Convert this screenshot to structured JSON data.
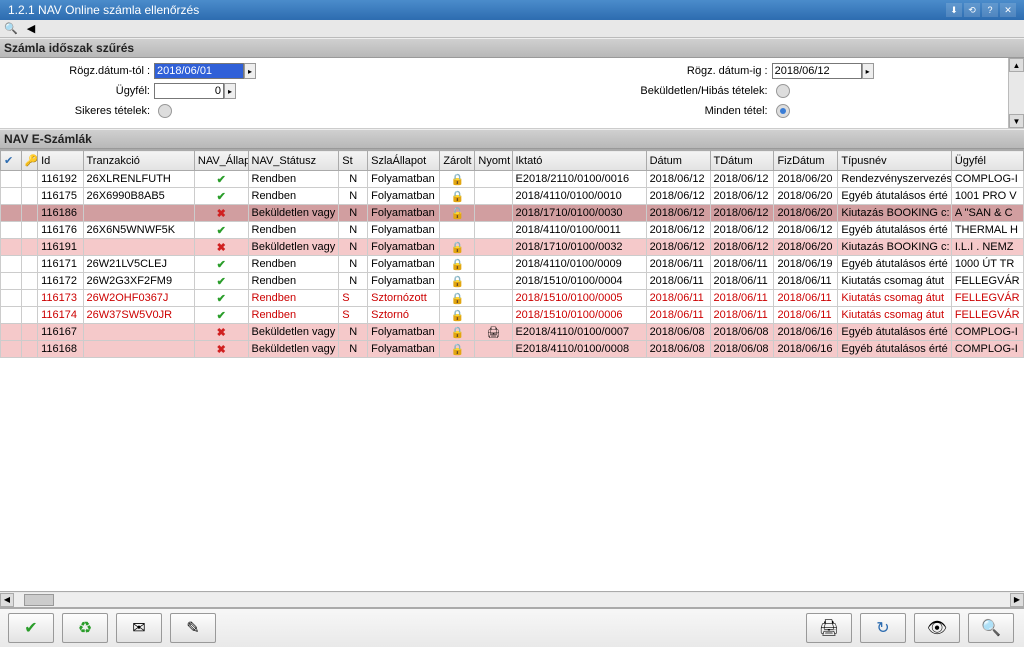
{
  "windowTitle": "1.2.1 NAV Online számla ellenőrzés",
  "filterHeader": "Számla időszak szűrés",
  "filters": {
    "rogzTolLabel": "Rögz.dátum-tól :",
    "rogzTolValue": "2018/06/01",
    "rogzIgLabel": "Rögz. dátum-ig :",
    "rogzIgValue": "2018/06/12",
    "ugyfelLabel": "Ügyfél:",
    "ugyfelValue": "0",
    "bekuldetlenLabel": "Beküldetlen/Hibás tételek:",
    "sikeresLabel": "Sikeres tételek:",
    "mindenLabel": "Minden tétel:"
  },
  "gridHeader": "NAV E-Számlák",
  "columns": {
    "id": "Id",
    "tranzakcio": "Tranzakció",
    "navAllap": "NAV_Állap",
    "navStatusz": "NAV_Státusz",
    "st": "St",
    "szlaAllapot": "SzlaÁllapot",
    "zarolt": "Zárolt",
    "nyomt": "Nyomt",
    "iktato": "Iktató",
    "datum": "Dátum",
    "tdatum": "TDátum",
    "fizdatum": "FizDátum",
    "tipusnev": "Típusnév",
    "ugyfel": "Ügyfél"
  },
  "rows": [
    {
      "id": "116192",
      "tran": "26XLRENLFUTH",
      "ok": true,
      "stat": "Rendben",
      "st": "N",
      "szla": "Folyamatban",
      "lock": "1",
      "ny": "",
      "ikt": "E2018/2110/0100/0016",
      "dat": "2018/06/12",
      "tdat": "2018/06/12",
      "fdat": "2018/06/20",
      "tip": "Rendezvényszervezés",
      "ugy": "COMPLOG-I",
      "cls": ""
    },
    {
      "id": "116175",
      "tran": "26X6990B8AB5",
      "ok": true,
      "stat": "Rendben",
      "st": "N",
      "szla": "Folyamatban",
      "lock": "1",
      "ny": "",
      "ikt": "2018/4110/0100/0010",
      "dat": "2018/06/12",
      "tdat": "2018/06/12",
      "fdat": "2018/06/20",
      "tip": "Egyéb átutalásos érté",
      "ugy": "1001 PRO V",
      "cls": ""
    },
    {
      "id": "116186",
      "tran": "",
      "ok": false,
      "stat": "Beküldetlen vagy",
      "st": "N",
      "szla": "Folyamatban",
      "lock": "2",
      "ny": "",
      "ikt": "2018/1710/0100/0030",
      "dat": "2018/06/12",
      "tdat": "2018/06/12",
      "fdat": "2018/06/20",
      "tip": "Kiutazás BOOKING c:",
      "ugy": "A \"SAN & C",
      "cls": "sel"
    },
    {
      "id": "116176",
      "tran": "26X6N5WNWF5K",
      "ok": true,
      "stat": "Rendben",
      "st": "N",
      "szla": "Folyamatban",
      "lock": "",
      "ny": "",
      "ikt": "2018/4110/0100/0011",
      "dat": "2018/06/12",
      "tdat": "2018/06/12",
      "fdat": "2018/06/12",
      "tip": "Egyéb átutalásos érté",
      "ugy": "THERMAL H",
      "cls": ""
    },
    {
      "id": "116191",
      "tran": "",
      "ok": false,
      "stat": "Beküldetlen vagy",
      "st": "N",
      "szla": "Folyamatban",
      "lock": "1",
      "ny": "",
      "ikt": "2018/1710/0100/0032",
      "dat": "2018/06/12",
      "tdat": "2018/06/12",
      "fdat": "2018/06/20",
      "tip": "Kiutazás BOOKING c:",
      "ugy": "I.L.I .  NEMZ",
      "cls": "pink"
    },
    {
      "id": "116171",
      "tran": "26W21LV5CLEJ",
      "ok": true,
      "stat": "Rendben",
      "st": "N",
      "szla": "Folyamatban",
      "lock": "1",
      "ny": "",
      "ikt": "2018/4110/0100/0009",
      "dat": "2018/06/11",
      "tdat": "2018/06/11",
      "fdat": "2018/06/19",
      "tip": "Egyéb átutalásos érté",
      "ugy": "1000 ÚT TR",
      "cls": ""
    },
    {
      "id": "116172",
      "tran": "26W2G3XF2FM9",
      "ok": true,
      "stat": "Rendben",
      "st": "N",
      "szla": "Folyamatban",
      "lock": "1",
      "ny": "",
      "ikt": "2018/1510/0100/0004",
      "dat": "2018/06/11",
      "tdat": "2018/06/11",
      "fdat": "2018/06/11",
      "tip": "Kiutatás  csomag átut",
      "ugy": "FELLEGVÁR",
      "cls": ""
    },
    {
      "id": "116173",
      "tran": "26W2OHF0367J",
      "ok": true,
      "stat": "Rendben",
      "st": "S",
      "szla": "Sztornózott",
      "lock": "1",
      "ny": "",
      "ikt": "2018/1510/0100/0005",
      "dat": "2018/06/11",
      "tdat": "2018/06/11",
      "fdat": "2018/06/11",
      "tip": "Kiutatás  csomag átut",
      "ugy": "FELLEGVÁR",
      "cls": "red"
    },
    {
      "id": "116174",
      "tran": "26W37SW5V0JR",
      "ok": true,
      "stat": "Rendben",
      "st": "S",
      "szla": "Sztornó",
      "lock": "1",
      "ny": "",
      "ikt": "2018/1510/0100/0006",
      "dat": "2018/06/11",
      "tdat": "2018/06/11",
      "fdat": "2018/06/11",
      "tip": "Kiutatás  csomag átut",
      "ugy": "FELLEGVÁR",
      "cls": "red"
    },
    {
      "id": "116167",
      "tran": "",
      "ok": false,
      "stat": "Beküldetlen vagy",
      "st": "N",
      "szla": "Folyamatban",
      "lock": "1",
      "ny": "p",
      "ikt": "E2018/4110/0100/0007",
      "dat": "2018/06/08",
      "tdat": "2018/06/08",
      "fdat": "2018/06/16",
      "tip": "Egyéb átutalásos érté",
      "ugy": "COMPLOG-I",
      "cls": "pink"
    },
    {
      "id": "116168",
      "tran": "",
      "ok": false,
      "stat": "Beküldetlen vagy",
      "st": "N",
      "szla": "Folyamatban",
      "lock": "1",
      "ny": "",
      "ikt": "E2018/4110/0100/0008",
      "dat": "2018/06/08",
      "tdat": "2018/06/08",
      "fdat": "2018/06/16",
      "tip": "Egyéb átutalásos érté",
      "ugy": "COMPLOG-I",
      "cls": "pink"
    }
  ]
}
